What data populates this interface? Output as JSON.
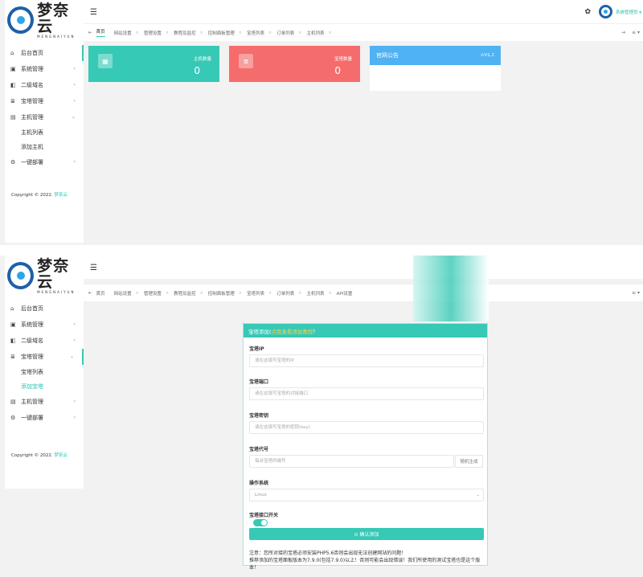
{
  "brand": {
    "cn": "梦奈云",
    "en": "MENGNAIYUN"
  },
  "user": {
    "name": "系统管理员 ▾"
  },
  "tabs": {
    "prev": "⇤",
    "top1": [
      "首页",
      "网站设置",
      "管理设置",
      "教程及监控",
      "控制面板管理",
      "宝塔列表",
      "订单列表",
      "主机列表"
    ],
    "top2": [
      "首页",
      "网站设置",
      "管理设置",
      "教程及监控",
      "控制面板管理",
      "宝塔列表",
      "订单列表",
      "主机列表",
      "API设置"
    ],
    "next": "⇥",
    "more": "≡ ▾"
  },
  "sidebar1": {
    "items": [
      {
        "label": "后台首页",
        "icon": "⌂"
      },
      {
        "label": "系统管理",
        "icon": "▣"
      },
      {
        "label": "二级域名",
        "icon": "◧"
      },
      {
        "label": "宝塔管理",
        "icon": "≣"
      },
      {
        "label": "主机管理",
        "icon": "▤"
      }
    ],
    "sub": [
      "主机列表",
      "添加主机"
    ],
    "last": {
      "label": "一键部署",
      "icon": "⚙"
    }
  },
  "sidebar2": {
    "items": [
      {
        "label": "后台首页",
        "icon": "⌂"
      },
      {
        "label": "系统管理",
        "icon": "▣"
      },
      {
        "label": "二级域名",
        "icon": "◧"
      },
      {
        "label": "宝塔管理",
        "icon": "≣"
      }
    ],
    "sub": [
      "宝塔列表",
      "添加宝塔"
    ],
    "after": [
      {
        "label": "主机管理",
        "icon": "▤"
      },
      {
        "label": "一键部署",
        "icon": "⚙"
      }
    ]
  },
  "copyright": {
    "text": "Copyright © 2022. ",
    "brand": "梦奈云"
  },
  "cards": [
    {
      "label": "主机数量",
      "value": "0",
      "color": "#36c9b5"
    },
    {
      "label": "宝塔数量",
      "value": "0",
      "color": "#f56c6c"
    }
  ],
  "notice": {
    "title": "官网公告",
    "version": "⊙V1.2"
  },
  "form": {
    "title_prefix": "宝塔添加(",
    "title_link": "点我查看添加教程",
    "title_suffix": ")",
    "fields": [
      {
        "label": "宝塔IP",
        "placeholder": "请在这填写宝塔的IP"
      },
      {
        "label": "宝塔端口",
        "placeholder": "请在这填写宝塔的对接端口"
      },
      {
        "label": "宝塔密钥",
        "placeholder": "请在这填写宝塔的密钥(key)"
      },
      {
        "label": "宝塔代号",
        "placeholder": "每台宝塔的编号"
      }
    ],
    "gen_button": "随机生成",
    "os_label": "操作系统",
    "os_value": "Linux",
    "switch_label": "宝塔接口开关",
    "submit": "⊙ 确认添加",
    "note1": "注意：您所对接的宝塔必须安装PHP5.6否则会出现无法创建网站的问题！",
    "note2": "推荐添加的宝塔面板版本为7.9.0(包括7.9.0)以上！否则可能会出现错误！我们所使用的测试宝塔也是这个版本！"
  }
}
